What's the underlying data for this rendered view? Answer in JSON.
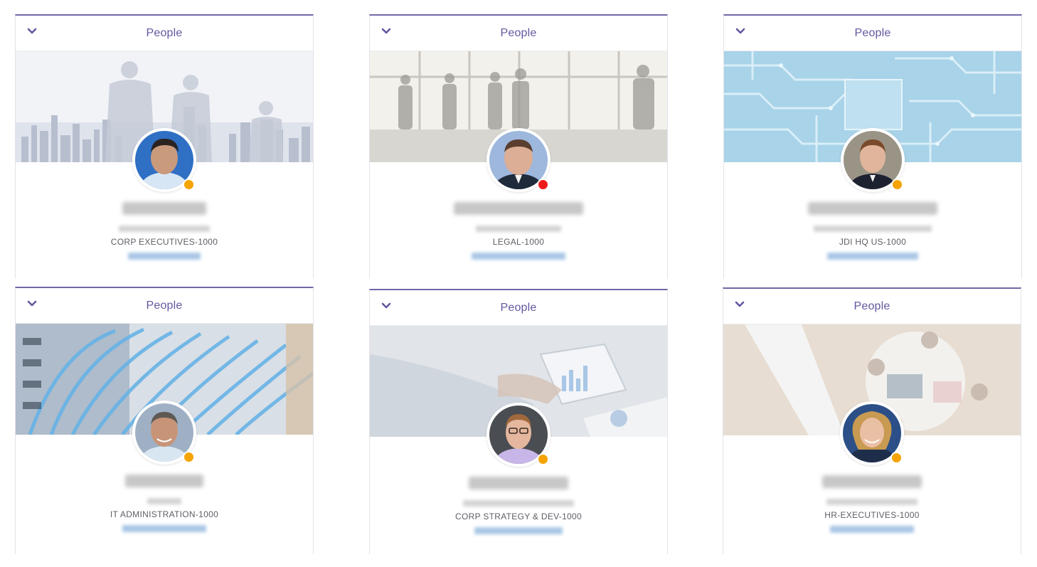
{
  "widget_title": "People",
  "colors": {
    "accent": "#7466a8",
    "title_text": "#6258a0",
    "status_away": "#f5a300",
    "status_busy": "#ef1b1b",
    "email_link": "#a9c7e6"
  },
  "icons": {
    "collapse": "chevron-down-icon"
  },
  "cards": [
    {
      "title": "People",
      "department": "CORP EXECUTIVES-1000",
      "status": "away",
      "status_color": "#f5a300",
      "banner": "city-skyline-business-people"
    },
    {
      "title": "People",
      "department": "LEGAL-1000",
      "status": "busy",
      "status_color": "#ef1b1b",
      "banner": "office-window-meeting"
    },
    {
      "title": "People",
      "department": "JDI HQ US-1000",
      "status": "away",
      "status_color": "#f5a300",
      "banner": "circuit-board"
    },
    {
      "title": "People",
      "department": "IT ADMINISTRATION-1000",
      "status": "away",
      "status_color": "#f5a300",
      "banner": "network-cables"
    },
    {
      "title": "People",
      "department": "CORP STRATEGY & DEV-1000",
      "status": "away",
      "status_color": "#f5a300",
      "banner": "tablet-charts"
    },
    {
      "title": "People",
      "department": "HR-EXECUTIVES-1000",
      "status": "away",
      "status_color": "#f5a300",
      "banner": "team-table-overhead"
    }
  ]
}
